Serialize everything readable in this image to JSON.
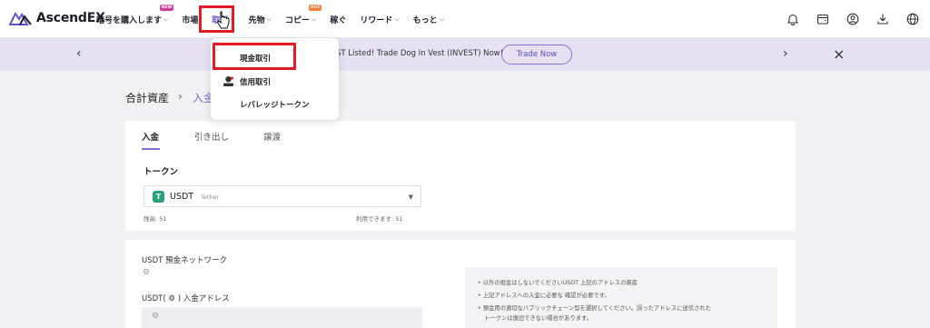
{
  "logo": {
    "text": "AscendEX"
  },
  "nav": {
    "items": [
      {
        "label": "暗号を購入します",
        "badge": "NEW"
      },
      {
        "label": "市場"
      },
      {
        "label": "取引"
      },
      {
        "label": "先物"
      },
      {
        "label": "コピー",
        "badge": "HOT"
      },
      {
        "label": "稼ぐ"
      },
      {
        "label": "リワード"
      },
      {
        "label": "もっと"
      }
    ],
    "tool_icons": [
      "bell-icon",
      "wallet-icon",
      "user-icon",
      "download-icon",
      "globe-icon"
    ]
  },
  "banner": {
    "text": "ST Listed! Trade Dog In Vest (INVEST) Now!",
    "button": "Trade Now"
  },
  "dropdown": {
    "items": [
      {
        "label": "現金取引"
      },
      {
        "label": "信用取引"
      },
      {
        "label": "レバレッジトークン"
      }
    ]
  },
  "breadcrumb": {
    "root": "合計資産",
    "current": "入金"
  },
  "tabs": [
    {
      "label": "入金",
      "active": true
    },
    {
      "label": "引き出し"
    },
    {
      "label": "譲渡"
    }
  ],
  "token": {
    "label": "トークン",
    "symbol": "USDT",
    "name": "Tether",
    "icon_letter": "T",
    "icon_color": "#26a17b",
    "balance": "残高: 51",
    "available": "利用できます: 51"
  },
  "network": {
    "label": "USDT 預金ネットワーク"
  },
  "address": {
    "label": "USDT( ⚙ ) 入金アドレス"
  },
  "notes": [
    "以外の担金はしないでくださいUSDT 上記のアドレスの資産",
    "上記アドレスへの入金に必要な 確認が必要です。",
    "預金用の適切なパブリックチェーン型を選択してください。誤ったアドレスに送信された",
    "トークンは復旧できない場合があります。"
  ],
  "colors": {
    "accent": "#8a6fd6",
    "highlight": "#e11d24"
  }
}
